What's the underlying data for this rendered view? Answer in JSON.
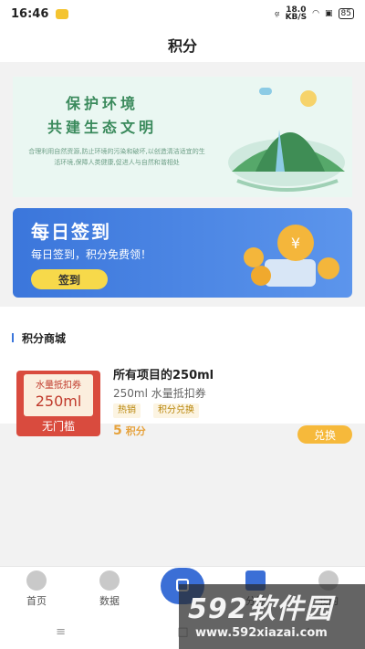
{
  "status_bar": {
    "time": "16:46",
    "speed_value": "18.0",
    "speed_unit": "KB/S",
    "battery": "85"
  },
  "header": {
    "title": "积分"
  },
  "eco_banner": {
    "slogan_line1": "保护环境",
    "slogan_line2": "共建生态文明",
    "description": "合理利用自然资源,防止环境的污染和破坏,以创造清洁适宜的生活环境,保障人类健康,促进人与自然和谐相处"
  },
  "checkin": {
    "title": "每日签到",
    "subtitle": "每日签到，积分免费领！",
    "button": "签到"
  },
  "shop": {
    "heading": "积分商城",
    "items": [
      {
        "coupon_type": "水量抵扣券",
        "coupon_value": "250ml",
        "coupon_footer": "无门槛",
        "title": "所有项目的250ml",
        "subtitle": "250ml 水量抵扣券",
        "tags": [
          "热销",
          "积分兑换"
        ],
        "points": "5",
        "points_unit": "积分",
        "button": "兑换"
      }
    ]
  },
  "tabbar": {
    "home": "首页",
    "data": "数据",
    "category": "分类",
    "mine": "我的"
  },
  "watermark": {
    "logo": "592软件园",
    "url": "www.592xiazai.com"
  },
  "colors": {
    "primary_blue": "#3b76db",
    "accent_yellow": "#f7d94a",
    "coupon_red": "#d94b3e",
    "points_orange": "#e6a23c"
  }
}
